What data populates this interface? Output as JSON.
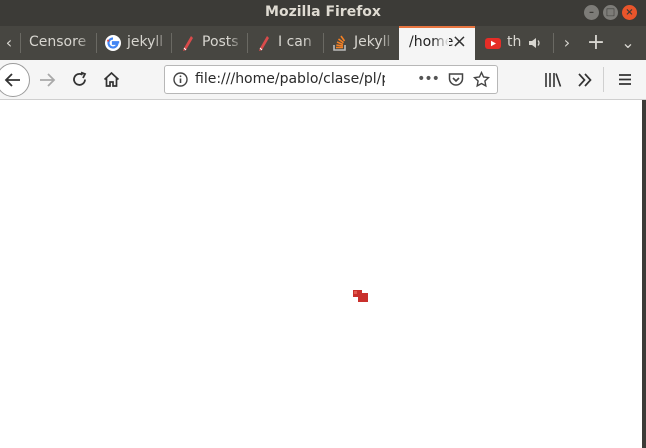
{
  "window": {
    "title": "Mozilla Firefox",
    "minimize_icon": "minimize-icon",
    "maximize_icon": "maximize-icon",
    "close_icon": "close-icon"
  },
  "tabs": [
    {
      "label": "Censore",
      "icon": "none",
      "active": false
    },
    {
      "label": "jekyll",
      "icon": "google-g-icon",
      "active": false
    },
    {
      "label": "Posts",
      "icon": "pen-icon",
      "active": false
    },
    {
      "label": "I can",
      "icon": "pen-icon",
      "active": false
    },
    {
      "label": "Jekyll",
      "icon": "stackoverflow-icon",
      "active": false
    },
    {
      "label": "/home",
      "icon": "none",
      "active": true
    },
    {
      "label": "th",
      "icon": "youtube-icon",
      "active": false
    }
  ],
  "tabbar": {
    "scroll_left": "‹",
    "scroll_right": "›",
    "new_tab": "+",
    "list_all": "⌄"
  },
  "navbar": {
    "url": "file:///home/pablo/clase/pl/p",
    "page_actions": "•••",
    "back_icon": "back-arrow-icon",
    "forward_icon": "forward-arrow-icon",
    "reload_icon": "reload-icon",
    "home_icon": "home-icon"
  },
  "accent_color": "#e7743f",
  "content_mark_color": "#c9302c"
}
